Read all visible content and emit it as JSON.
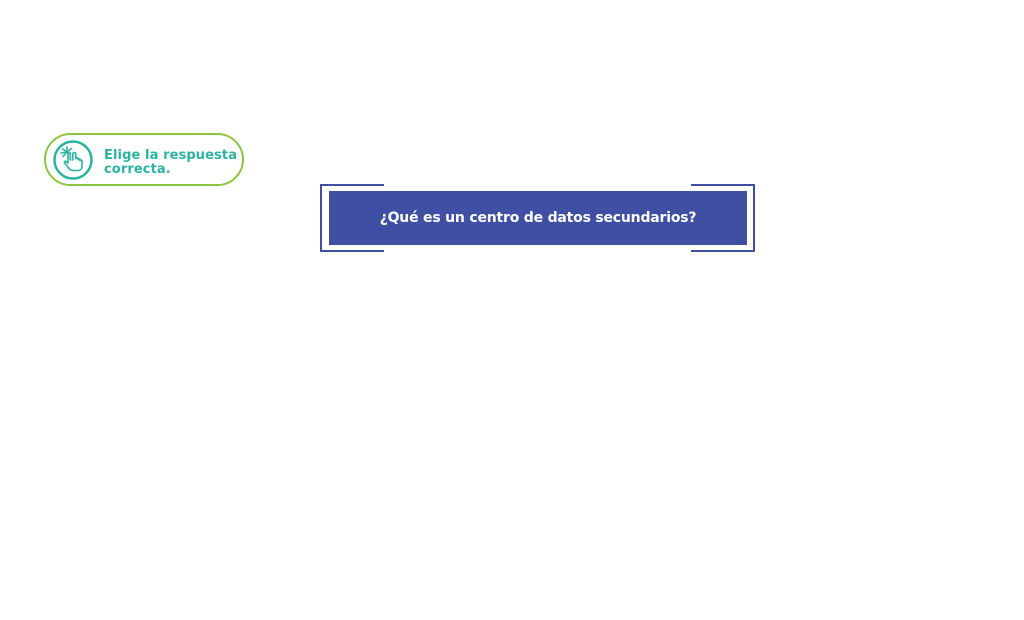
{
  "instruction": {
    "text": "Elige la respuesta correcta.",
    "icon": "tap-hand-icon",
    "border_color": "#8cc63f",
    "accent_color": "#2bb3a3"
  },
  "question": {
    "text": "¿Qué es un centro de datos secundarios?",
    "background_color": "#3f4fa3"
  }
}
